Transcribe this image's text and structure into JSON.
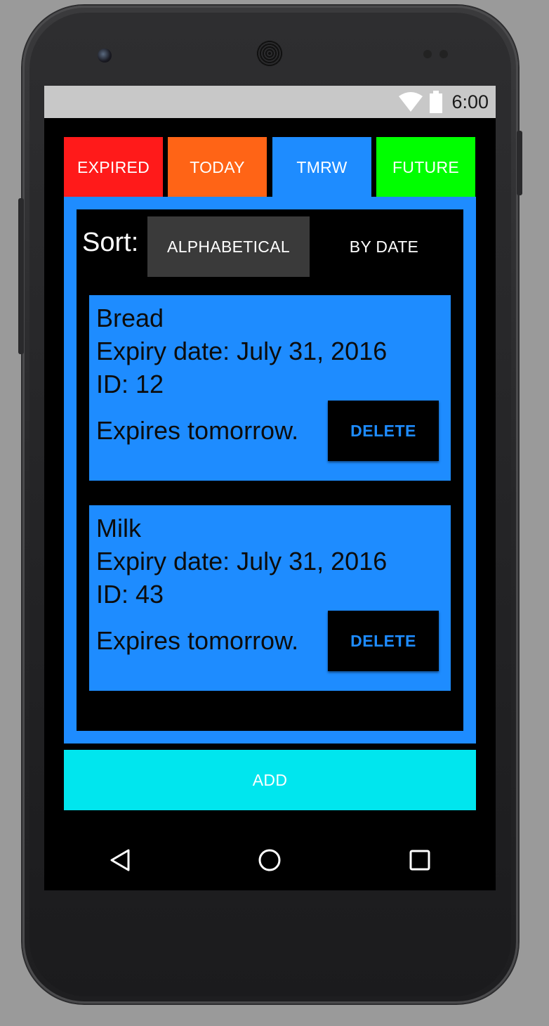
{
  "status_bar": {
    "time": "6:00",
    "icons": [
      "wifi-icon",
      "battery-icon"
    ]
  },
  "tabs": [
    {
      "label": "EXPIRED",
      "color": "#ff1a1a"
    },
    {
      "label": "TODAY",
      "color": "#ff6416"
    },
    {
      "label": "TMRW",
      "color": "#1e8cff",
      "selected": true
    },
    {
      "label": "FUTURE",
      "color": "#00ff00"
    }
  ],
  "sort": {
    "label": "Sort:",
    "options": [
      "ALPHABETICAL",
      "BY DATE"
    ],
    "selected": "ALPHABETICAL"
  },
  "items": [
    {
      "name": "Bread",
      "expiry": "Expiry date: July 31, 2016",
      "id": "ID: 12",
      "status": "Expires tomorrow.",
      "delete_label": "DELETE"
    },
    {
      "name": "Milk",
      "expiry": "Expiry date: July 31, 2016",
      "id": "ID: 43",
      "status": "Expires tomorrow.",
      "delete_label": "DELETE"
    }
  ],
  "add_label": "ADD",
  "nav": [
    "back-icon",
    "home-icon",
    "recent-apps-icon"
  ],
  "colors": {
    "accent": "#1e8cff",
    "add": "#00e6ee",
    "background": "#000000"
  }
}
